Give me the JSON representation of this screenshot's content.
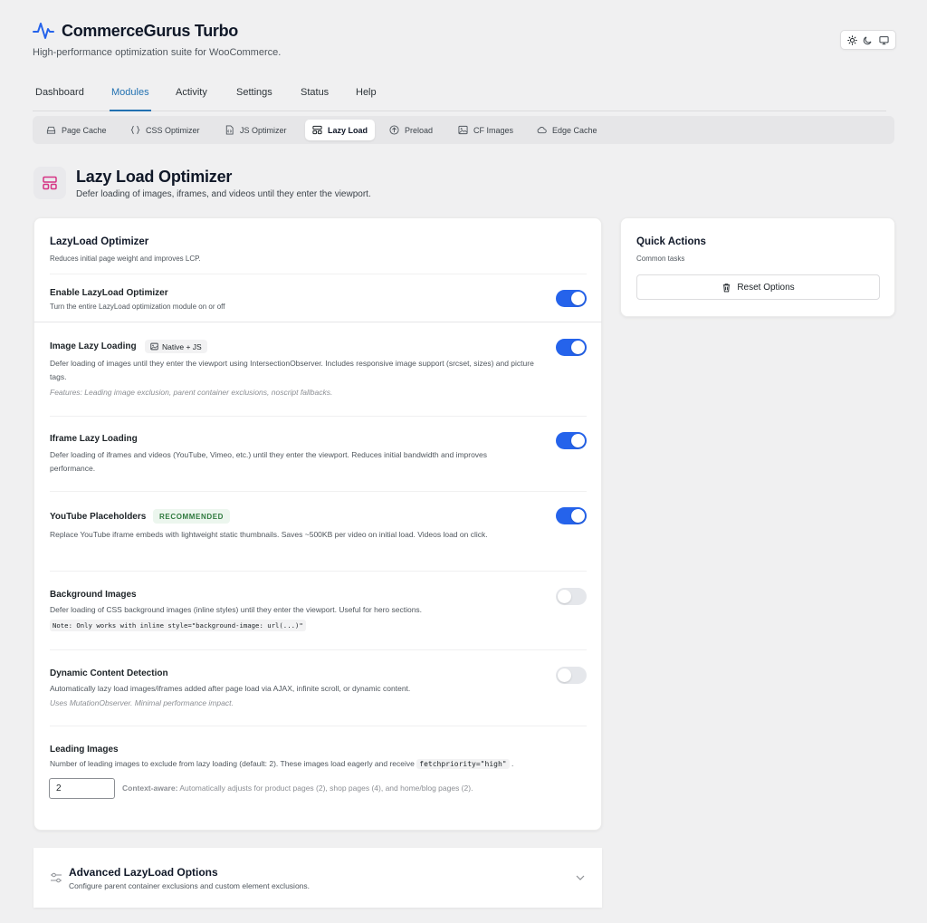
{
  "header": {
    "title": "CommerceGurus Turbo",
    "subtitle": "High-performance optimization suite for WooCommerce.",
    "logo_icon": "pulse-icon",
    "theme_icons": [
      "sun-icon",
      "moon-icon",
      "monitor-icon"
    ]
  },
  "main_tabs": [
    {
      "label": "Dashboard"
    },
    {
      "label": "Modules"
    },
    {
      "label": "Activity"
    },
    {
      "label": "Settings"
    },
    {
      "label": "Status"
    },
    {
      "label": "Help"
    }
  ],
  "active_main_tab": "Modules",
  "sub_tabs": [
    {
      "label": "Page Cache",
      "icon": "drive-icon"
    },
    {
      "label": "CSS Optimizer",
      "icon": "braces-icon"
    },
    {
      "label": "JS Optimizer",
      "icon": "file-code-icon"
    },
    {
      "label": "Lazy Load",
      "icon": "layout-icon"
    },
    {
      "label": "Preload",
      "icon": "arrow-up-circle-icon"
    },
    {
      "label": "CF Images",
      "icon": "image-icon"
    },
    {
      "label": "Edge Cache",
      "icon": "cloud-icon"
    }
  ],
  "active_sub_tab": "Lazy Load",
  "page": {
    "title": "Lazy Load Optimizer",
    "subtitle": "Defer loading of images, iframes, and videos until they enter the viewport."
  },
  "main_card": {
    "title": "LazyLoad Optimizer",
    "subtitle": "Reduces initial page weight and improves LCP.",
    "settings": {
      "enable": {
        "title": "Enable LazyLoad Optimizer",
        "desc": "Turn the entire LazyLoad optimization module on or off",
        "enabled": true
      },
      "image": {
        "title": "Image Lazy Loading",
        "badge": "Native + JS",
        "desc": "Defer loading of images until they enter the viewport using IntersectionObserver. Includes responsive image support (srcset, sizes) and picture tags.",
        "note": "Features: Leading image exclusion, parent container exclusions, noscript fallbacks.",
        "enabled": true
      },
      "iframe": {
        "title": "Iframe Lazy Loading",
        "desc": "Defer loading of iframes and videos (YouTube, Vimeo, etc.) until they enter the viewport. Reduces initial bandwidth and improves performance.",
        "enabled": true
      },
      "youtube": {
        "title": "YouTube Placeholders",
        "badge": "RECOMMENDED",
        "desc": "Replace YouTube iframe embeds with lightweight static thumbnails. Saves ~500KB per video on initial load. Videos load on click.",
        "enabled": true
      },
      "background": {
        "title": "Background Images",
        "desc": "Defer loading of CSS background images (inline styles) until they enter the viewport. Useful for hero sections.",
        "note_code": "Note: Only works with inline style=\"background-image: url(...)\"",
        "enabled": false
      },
      "dynamic": {
        "title": "Dynamic Content Detection",
        "desc": "Automatically lazy load images/iframes added after page load via AJAX, infinite scroll, or dynamic content.",
        "note": "Uses MutationObserver. Minimal performance impact.",
        "enabled": false
      },
      "leading": {
        "title": "Leading Images",
        "desc_prefix": "Number of leading images to exclude from lazy loading (default: 2). These images load eagerly and receive",
        "desc_code": "fetchpriority=\"high\"",
        "desc_suffix": ".",
        "value": "2",
        "context_label": "Context-aware:",
        "context_text": "Automatically adjusts for product pages (2), shop pages (4), and home/blog pages (2)."
      }
    }
  },
  "quick_actions": {
    "title": "Quick Actions",
    "subtitle": "Common tasks",
    "reset_label": "Reset Options",
    "reset_icon": "trash-icon"
  },
  "advanced": {
    "title": "Advanced LazyLoad Options",
    "subtitle": "Configure parent container exclusions and custom element exclusions.",
    "icon": "sliders-icon",
    "chevron": "chevron-down-icon"
  },
  "colors": {
    "accent": "#2563eb",
    "tab_active": "#2271b1",
    "page_icon": "#d63384",
    "badge_green": "#2f7a3e"
  }
}
